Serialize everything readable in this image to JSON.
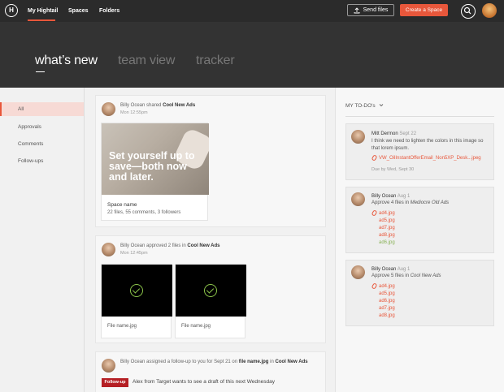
{
  "topbar": {
    "logo": "H",
    "nav": [
      "My Hightail",
      "Spaces",
      "Folders"
    ],
    "send_files": "Send files",
    "create_space": "Create a Space"
  },
  "hero": {
    "tabs": [
      "what’s new",
      "team view",
      "tracker"
    ]
  },
  "sidebar": {
    "items": [
      "All",
      "Approvals",
      "Comments",
      "Follow-ups"
    ]
  },
  "feed": [
    {
      "user": "Billy Ocean",
      "action": "shared",
      "target": "Cool New Ads",
      "time": "Mon 12:55pm",
      "image_text": "Set yourself up to save—both now and later.",
      "space_name": "Space name",
      "space_stats": "22 files, 55 comments, 3 followers"
    },
    {
      "user": "Billy Ocean",
      "action": "approved 2 files in",
      "target": "Cool New Ads",
      "time": "Mon 12:45pm",
      "files": [
        "File name.jpg",
        "File name.jpg"
      ]
    },
    {
      "user": "Billy Ocean",
      "action": "assigned a follow-up to you for Sept 21 on",
      "file": "file name.jpg",
      "in": "in",
      "target": "Cool New Ads",
      "tag": "Follow-up",
      "message": "Alex from Target wants to see a draft of this next Wednesday"
    }
  ],
  "todo": {
    "header": "MY TO-DO's",
    "items": [
      {
        "name": "Mitt Dermon",
        "date": "Sept 22",
        "text": "I think we need to lighten the colors in this image so that lorem ipsum.",
        "attachment": "VW_OilInstantOfferEmail_Non5XP_Desk...jpeg",
        "due": "Due by Wed, Sept 30"
      },
      {
        "name": "Billy Ocean",
        "date": "Aug 1",
        "text_prefix": "Approve 4 files in",
        "target": "Mediocre Old Ads",
        "files": [
          "ad4.jpg",
          "ad5.jpg",
          "ad7.jpg",
          "ad8.jpg",
          "ad6.jpg"
        ]
      },
      {
        "name": "Billy Ocean",
        "date": "Aug 1",
        "text_prefix": "Approve 5 files in",
        "target": "Cool New Ads",
        "files": [
          "ad4.jpg",
          "ad5.jpg",
          "ad6.jpg",
          "ad7.jpg",
          "ad8.jpg"
        ]
      }
    ]
  }
}
